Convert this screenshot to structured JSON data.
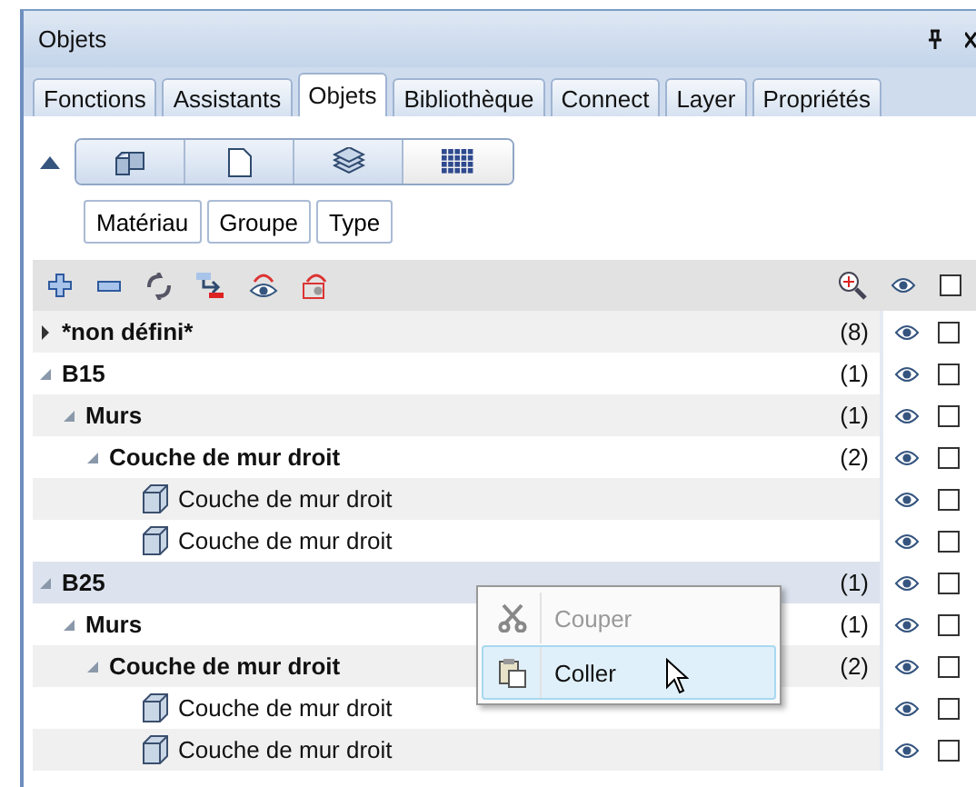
{
  "window": {
    "title": "Objets"
  },
  "tabs": [
    {
      "label": "Fonctions",
      "selected": false
    },
    {
      "label": "Assistants",
      "selected": false
    },
    {
      "label": "Objets",
      "selected": true
    },
    {
      "label": "Bibliothèque",
      "selected": false
    },
    {
      "label": "Connect",
      "selected": false
    },
    {
      "label": "Layer",
      "selected": false
    },
    {
      "label": "Propriétés",
      "selected": false
    }
  ],
  "view_buttons": [
    {
      "kind": "blocks",
      "selected": false
    },
    {
      "kind": "page",
      "selected": false
    },
    {
      "kind": "layers",
      "selected": false
    },
    {
      "kind": "grid",
      "selected": true
    }
  ],
  "filter_buttons": [
    "Matériau",
    "Groupe",
    "Type"
  ],
  "toolbar": {
    "checked": false
  },
  "tree": [
    {
      "kind": "group",
      "label": "*non défini*",
      "count": "(8)",
      "expanded": false,
      "selected": false,
      "checked": false
    },
    {
      "kind": "group",
      "label": "B15",
      "count": "(1)",
      "expanded": true,
      "selected": false,
      "checked": false,
      "children": [
        {
          "kind": "group",
          "label": "Murs",
          "count": "(1)",
          "expanded": true,
          "selected": false,
          "checked": false,
          "children": [
            {
              "kind": "group",
              "label": "Couche de mur droit",
              "count": "(2)",
              "expanded": true,
              "selected": false,
              "checked": false,
              "children": [
                {
                  "kind": "item",
                  "label": "Couche de mur droit",
                  "selected": false,
                  "checked": false
                },
                {
                  "kind": "item",
                  "label": "Couche de mur droit",
                  "selected": false,
                  "checked": false
                }
              ]
            }
          ]
        }
      ]
    },
    {
      "kind": "group",
      "label": "B25",
      "count": "(1)",
      "expanded": true,
      "selected": true,
      "checked": false,
      "children": [
        {
          "kind": "group",
          "label": "Murs",
          "count": "(1)",
          "expanded": true,
          "selected": false,
          "checked": false,
          "children": [
            {
              "kind": "group",
              "label": "Couche de mur droit",
              "count": "(2)",
              "expanded": true,
              "selected": false,
              "checked": false,
              "children": [
                {
                  "kind": "item",
                  "label": "Couche de mur droit",
                  "selected": false,
                  "checked": false
                },
                {
                  "kind": "item",
                  "label": "Couche de mur droit",
                  "selected": false,
                  "checked": false
                }
              ]
            }
          ]
        }
      ]
    }
  ],
  "context_menu": [
    {
      "kind": "cut",
      "label": "Couper",
      "disabled": true,
      "selected": false
    },
    {
      "kind": "paste",
      "label": "Coller",
      "disabled": false,
      "selected": true
    }
  ]
}
